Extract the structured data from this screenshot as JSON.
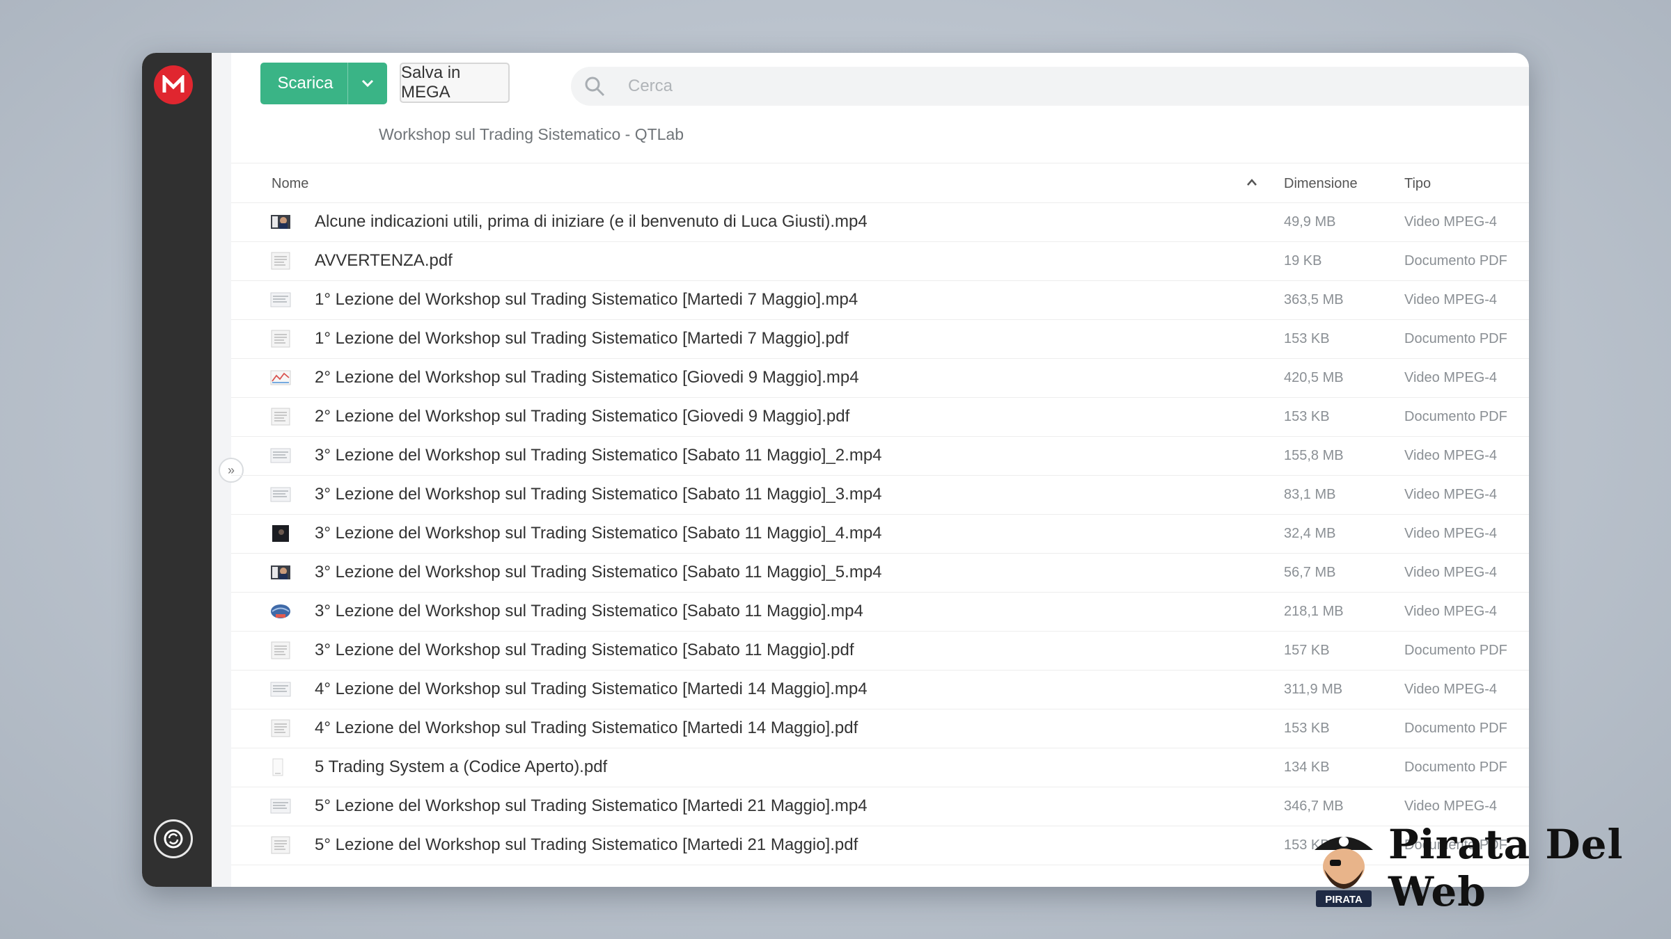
{
  "toolbar": {
    "download_label": "Scarica",
    "save_label": "Salva in MEGA",
    "search_placeholder": "Cerca"
  },
  "breadcrumb": "Workshop sul Trading Sistematico - QTLab",
  "columns": {
    "name": "Nome",
    "size": "Dimensione",
    "type": "Tipo"
  },
  "files": [
    {
      "name": "Alcune indicazioni utili, prima di iniziare (e il benvenuto di Luca Giusti).mp4",
      "size": "49,9 MB",
      "type": "Video MPEG-4",
      "thumb": "video-dark"
    },
    {
      "name": "AVVERTENZA.pdf",
      "size": "19 KB",
      "type": "Documento PDF",
      "thumb": "doc"
    },
    {
      "name": "1° Lezione del Workshop sul Trading Sistematico [Martedi 7 Maggio].mp4",
      "size": "363,5 MB",
      "type": "Video MPEG-4",
      "thumb": "video-light"
    },
    {
      "name": "1° Lezione del Workshop sul Trading Sistematico [Martedi 7 Maggio].pdf",
      "size": "153 KB",
      "type": "Documento PDF",
      "thumb": "doc"
    },
    {
      "name": "2° Lezione del Workshop sul Trading Sistematico [Giovedi 9 Maggio].mp4",
      "size": "420,5 MB",
      "type": "Video MPEG-4",
      "thumb": "video-chart"
    },
    {
      "name": "2° Lezione del Workshop sul Trading Sistematico [Giovedi 9 Maggio].pdf",
      "size": "153 KB",
      "type": "Documento PDF",
      "thumb": "doc"
    },
    {
      "name": "3° Lezione del Workshop sul Trading Sistematico [Sabato 11 Maggio]_2.mp4",
      "size": "155,8 MB",
      "type": "Video MPEG-4",
      "thumb": "video-light"
    },
    {
      "name": "3° Lezione del Workshop sul Trading Sistematico [Sabato 11 Maggio]_3.mp4",
      "size": "83,1 MB",
      "type": "Video MPEG-4",
      "thumb": "video-light"
    },
    {
      "name": "3° Lezione del Workshop sul Trading Sistematico [Sabato 11 Maggio]_4.mp4",
      "size": "32,4 MB",
      "type": "Video MPEG-4",
      "thumb": "video-black"
    },
    {
      "name": "3° Lezione del Workshop sul Trading Sistematico [Sabato 11 Maggio]_5.mp4",
      "size": "56,7 MB",
      "type": "Video MPEG-4",
      "thumb": "video-dark"
    },
    {
      "name": "3° Lezione del Workshop sul Trading Sistematico [Sabato 11 Maggio].mp4",
      "size": "218,1 MB",
      "type": "Video MPEG-4",
      "thumb": "video-blue"
    },
    {
      "name": "3° Lezione del Workshop sul Trading Sistematico [Sabato 11 Maggio].pdf",
      "size": "157 KB",
      "type": "Documento PDF",
      "thumb": "doc"
    },
    {
      "name": "4° Lezione del Workshop sul Trading Sistematico [Martedi 14 Maggio].mp4",
      "size": "311,9 MB",
      "type": "Video MPEG-4",
      "thumb": "video-light"
    },
    {
      "name": "4° Lezione del Workshop sul Trading Sistematico [Martedi 14 Maggio].pdf",
      "size": "153 KB",
      "type": "Documento PDF",
      "thumb": "doc"
    },
    {
      "name": "5 Trading System a (Codice Aperto).pdf",
      "size": "134 KB",
      "type": "Documento PDF",
      "thumb": "doc-blank"
    },
    {
      "name": "5° Lezione del Workshop sul Trading Sistematico [Martedi 21 Maggio].mp4",
      "size": "346,7 MB",
      "type": "Video MPEG-4",
      "thumb": "video-light"
    },
    {
      "name": "5° Lezione del Workshop sul Trading Sistematico [Martedi 21 Maggio].pdf",
      "size": "153 KB",
      "type": "Documento PDF",
      "thumb": "doc"
    }
  ],
  "watermark": {
    "text": "Pirata Del Web",
    "badge_text": "PIRATA"
  },
  "colors": {
    "accent": "#3ab486",
    "logo": "#e0262f",
    "sidebar": "#303030"
  }
}
